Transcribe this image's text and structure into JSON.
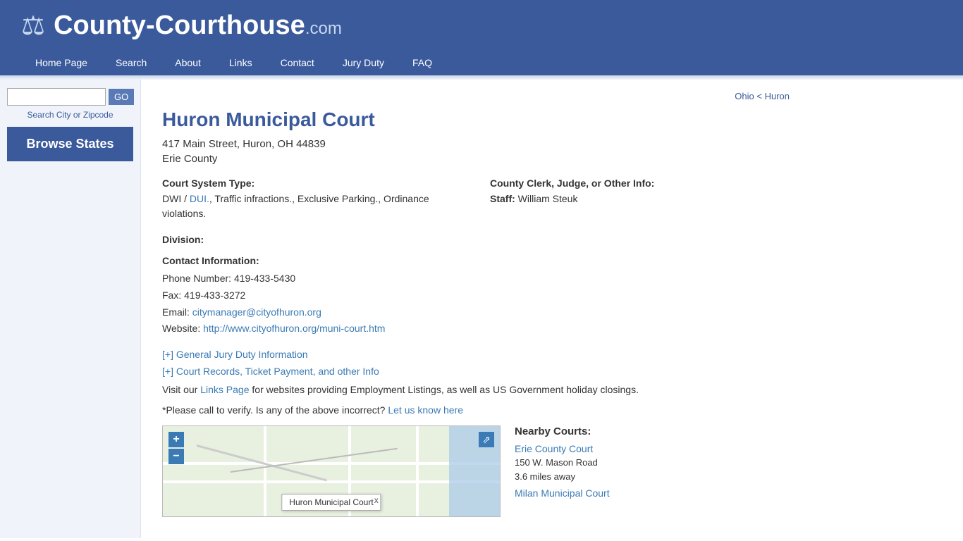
{
  "header": {
    "logo_text": "County-Courthouse",
    "logo_com": ".com",
    "logo_icon": "⚖",
    "nav": [
      {
        "label": "Home Page",
        "id": "nav-home"
      },
      {
        "label": "Search",
        "id": "nav-search"
      },
      {
        "label": "About",
        "id": "nav-about"
      },
      {
        "label": "Links",
        "id": "nav-links"
      },
      {
        "label": "Contact",
        "id": "nav-contact"
      },
      {
        "label": "Jury Duty",
        "id": "nav-jury"
      },
      {
        "label": "FAQ",
        "id": "nav-faq"
      }
    ]
  },
  "sidebar": {
    "search_placeholder": "",
    "go_button": "GO",
    "search_label": "Search City or Zipcode",
    "browse_states": "Browse States"
  },
  "breadcrumb": {
    "state": "Ohio",
    "separator": " < ",
    "county": "Huron"
  },
  "court": {
    "title": "Huron Municipal Court",
    "address": "417 Main Street, Huron, OH 44839",
    "county": "Erie County",
    "court_system_label": "Court System Type:",
    "court_system_value": "DWI / DUI., Traffic infractions., Exclusive Parking., Ordinance violations.",
    "court_system_links": [
      "DUI."
    ],
    "county_clerk_label": "County Clerk, Judge, or Other Info:",
    "staff_label": "Staff:",
    "staff_value": "William Steuk",
    "division_label": "Division:",
    "division_value": "",
    "contact_label": "Contact Information:",
    "phone_label": "Phone Number:",
    "phone_value": "419-433-5430",
    "fax_label": "Fax:",
    "fax_value": "419-433-3272",
    "email_label": "Email:",
    "email_value": "citymanager@cityofhuron.org",
    "website_label": "Website:",
    "website_value": "http://www.cityofhuron.org/muni-court.htm",
    "jury_duty_link": "[+] General Jury Duty Information",
    "court_records_link": "[+] Court Records, Ticket Payment, and other Info",
    "links_text_pre": "Visit our ",
    "links_page": "Links Page",
    "links_text_post": " for websites providing Employment Listings, as well as US Government holiday closings.",
    "verify_text_pre": "*Please call to verify. Is any of the above incorrect? ",
    "verify_link": "Let us know here",
    "map_popup": "Huron Municipal Court",
    "map_close": "x"
  },
  "nearby": {
    "title": "Nearby Courts:",
    "courts": [
      {
        "name": "Erie County Court",
        "address": "150 W. Mason Road",
        "distance": "3.6 miles away"
      },
      {
        "name": "Milan Municipal Court",
        "address": "",
        "distance": ""
      }
    ]
  }
}
